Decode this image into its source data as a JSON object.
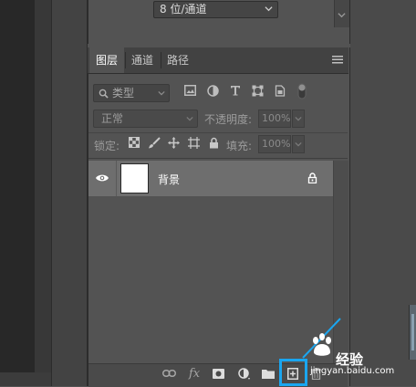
{
  "top_panel": {
    "bit_depth_value": "8 位/通道"
  },
  "layers_panel": {
    "tabs": [
      {
        "label": "图层",
        "active": true
      },
      {
        "label": "通道",
        "active": false
      },
      {
        "label": "路径",
        "active": false
      }
    ],
    "filter": {
      "label": "类型"
    },
    "blend_mode": "正常",
    "opacity_label": "不透明度:",
    "opacity_value": "100%",
    "lock_label": "锁定:",
    "fill_label": "填充:",
    "fill_value": "100%",
    "layers": [
      {
        "name": "背景",
        "visible": true,
        "locked": true
      }
    ]
  },
  "footer_icons": [
    "link-icon",
    "fx-icon",
    "mask-icon",
    "adjustment-icon",
    "folder-icon",
    "new-layer-icon",
    "trash-icon"
  ],
  "watermark": {
    "text": "经验",
    "url": "jingyan.baidu.com"
  },
  "highlight_color": "#1aa6f0"
}
